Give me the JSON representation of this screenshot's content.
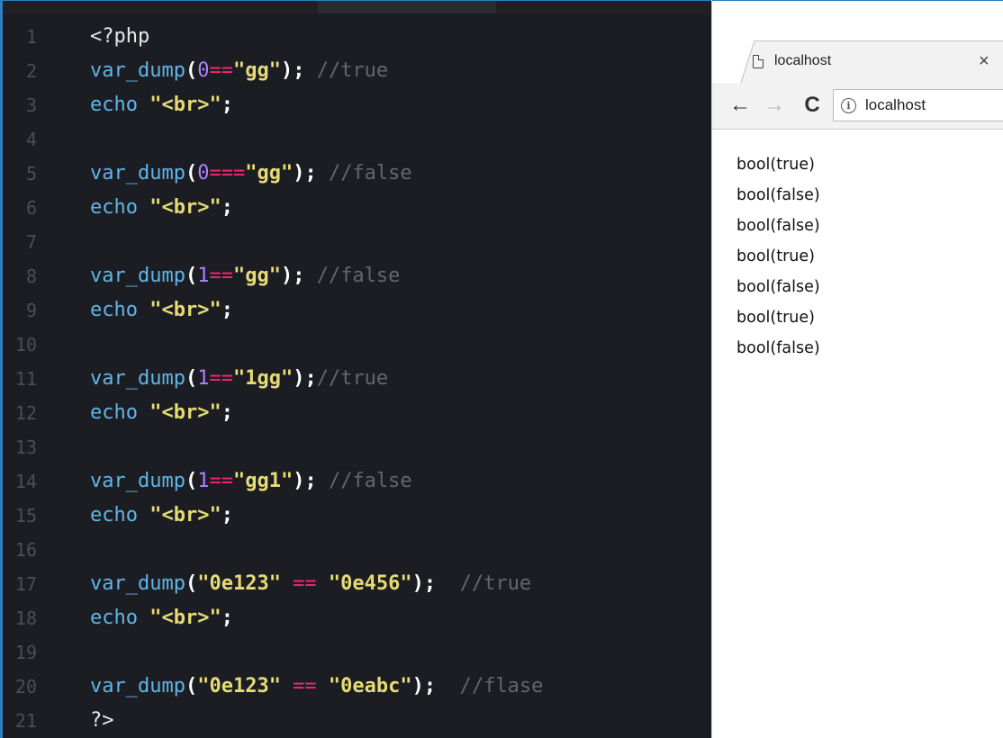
{
  "editor": {
    "lines": [
      {
        "n": "1",
        "tokens": [
          {
            "t": "<?php",
            "c": "kw"
          }
        ]
      },
      {
        "n": "2",
        "tokens": [
          {
            "t": "var_dump",
            "c": "fn"
          },
          {
            "t": "(",
            "c": "par"
          },
          {
            "t": "0",
            "c": "num"
          },
          {
            "t": "==",
            "c": "op"
          },
          {
            "t": "\"gg\"",
            "c": "str"
          },
          {
            "t": ");",
            "c": "par"
          },
          {
            "t": " //true",
            "c": "cmt"
          }
        ]
      },
      {
        "n": "3",
        "tokens": [
          {
            "t": "echo ",
            "c": "fn"
          },
          {
            "t": "\"<br>\"",
            "c": "str"
          },
          {
            "t": ";",
            "c": "par"
          }
        ]
      },
      {
        "n": "4",
        "tokens": []
      },
      {
        "n": "5",
        "tokens": [
          {
            "t": "var_dump",
            "c": "fn"
          },
          {
            "t": "(",
            "c": "par"
          },
          {
            "t": "0",
            "c": "num"
          },
          {
            "t": "===",
            "c": "op"
          },
          {
            "t": "\"gg\"",
            "c": "str"
          },
          {
            "t": ");",
            "c": "par"
          },
          {
            "t": " //false",
            "c": "cmt"
          }
        ]
      },
      {
        "n": "6",
        "tokens": [
          {
            "t": "echo ",
            "c": "fn"
          },
          {
            "t": "\"<br>\"",
            "c": "str"
          },
          {
            "t": ";",
            "c": "par"
          }
        ]
      },
      {
        "n": "7",
        "tokens": []
      },
      {
        "n": "8",
        "tokens": [
          {
            "t": "var_dump",
            "c": "fn"
          },
          {
            "t": "(",
            "c": "par"
          },
          {
            "t": "1",
            "c": "num"
          },
          {
            "t": "==",
            "c": "op"
          },
          {
            "t": "\"gg\"",
            "c": "str"
          },
          {
            "t": ");",
            "c": "par"
          },
          {
            "t": " //false",
            "c": "cmt"
          }
        ]
      },
      {
        "n": "9",
        "tokens": [
          {
            "t": "echo ",
            "c": "fn"
          },
          {
            "t": "\"<br>\"",
            "c": "str"
          },
          {
            "t": ";",
            "c": "par"
          }
        ]
      },
      {
        "n": "10",
        "tokens": []
      },
      {
        "n": "11",
        "tokens": [
          {
            "t": "var_dump",
            "c": "fn"
          },
          {
            "t": "(",
            "c": "par"
          },
          {
            "t": "1",
            "c": "num"
          },
          {
            "t": "==",
            "c": "op"
          },
          {
            "t": "\"1gg\"",
            "c": "str"
          },
          {
            "t": ");",
            "c": "par"
          },
          {
            "t": "//true",
            "c": "cmt"
          }
        ]
      },
      {
        "n": "12",
        "tokens": [
          {
            "t": "echo ",
            "c": "fn"
          },
          {
            "t": "\"<br>\"",
            "c": "str"
          },
          {
            "t": ";",
            "c": "par"
          }
        ]
      },
      {
        "n": "13",
        "tokens": []
      },
      {
        "n": "14",
        "tokens": [
          {
            "t": "var_dump",
            "c": "fn"
          },
          {
            "t": "(",
            "c": "par"
          },
          {
            "t": "1",
            "c": "num"
          },
          {
            "t": "==",
            "c": "op"
          },
          {
            "t": "\"gg1\"",
            "c": "str"
          },
          {
            "t": ");",
            "c": "par"
          },
          {
            "t": " //false",
            "c": "cmt"
          }
        ]
      },
      {
        "n": "15",
        "tokens": [
          {
            "t": "echo ",
            "c": "fn"
          },
          {
            "t": "\"<br>\"",
            "c": "str"
          },
          {
            "t": ";",
            "c": "par"
          }
        ]
      },
      {
        "n": "16",
        "tokens": []
      },
      {
        "n": "17",
        "tokens": [
          {
            "t": "var_dump",
            "c": "fn"
          },
          {
            "t": "(",
            "c": "par"
          },
          {
            "t": "\"0e123\"",
            "c": "str"
          },
          {
            "t": " == ",
            "c": "op"
          },
          {
            "t": "\"0e456\"",
            "c": "str"
          },
          {
            "t": ");",
            "c": "par"
          },
          {
            "t": "  //true",
            "c": "cmt"
          }
        ]
      },
      {
        "n": "18",
        "tokens": [
          {
            "t": "echo ",
            "c": "fn"
          },
          {
            "t": "\"<br>\"",
            "c": "str"
          },
          {
            "t": ";",
            "c": "par"
          }
        ]
      },
      {
        "n": "19",
        "tokens": []
      },
      {
        "n": "20",
        "tokens": [
          {
            "t": "var_dump",
            "c": "fn"
          },
          {
            "t": "(",
            "c": "par"
          },
          {
            "t": "\"0e123\"",
            "c": "str"
          },
          {
            "t": " == ",
            "c": "op"
          },
          {
            "t": "\"0eabc\"",
            "c": "str"
          },
          {
            "t": ");",
            "c": "par"
          },
          {
            "t": "  //flase",
            "c": "cmt"
          }
        ]
      },
      {
        "n": "21",
        "tokens": [
          {
            "t": "?>",
            "c": "kw"
          }
        ]
      }
    ]
  },
  "browser": {
    "tab_title": "localhost",
    "tab_close": "×",
    "nav": {
      "back": "←",
      "forward": "→",
      "reload": "C"
    },
    "address": "localhost",
    "info_glyph": "i",
    "output": [
      "bool(true)",
      "bool(false)",
      "bool(false)",
      "bool(true)",
      "bool(false)",
      "bool(true)",
      "bool(false)"
    ]
  },
  "colors": {
    "editor_bg": "#1b1d23",
    "function": "#5fb6e8",
    "number": "#ae81ff",
    "operator": "#f92672",
    "string": "#e6db74",
    "comment": "#63666f",
    "accent_border": "#2d7fc1"
  },
  "icons": [
    "page-icon",
    "tab-close-icon",
    "back-arrow-icon",
    "forward-arrow-icon",
    "reload-icon",
    "info-icon"
  ]
}
